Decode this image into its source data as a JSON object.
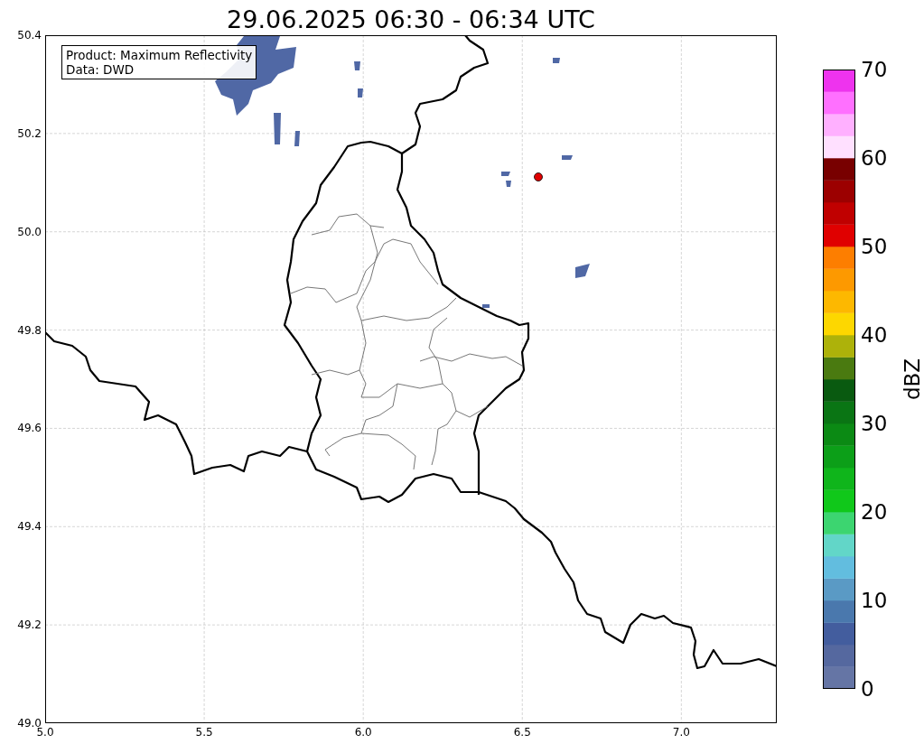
{
  "title": "29.06.2025 06:30 - 06:34 UTC",
  "info_box": {
    "lines": [
      "Product: Maximum Reflectivity",
      "Data: DWD"
    ]
  },
  "map": {
    "yticks": [
      "50.4",
      "50.2",
      "50.0",
      "49.8",
      "49.6",
      "49.4",
      "49.2",
      "49.0"
    ],
    "xticks": [
      "5.0",
      "5.5",
      "6.0",
      "6.5",
      "7.0"
    ]
  },
  "colorbar": {
    "label": "dBZ",
    "ticks": [
      "70",
      "60",
      "50",
      "40",
      "30",
      "20",
      "10",
      "0"
    ],
    "segments": [
      {
        "color": "#6575a5"
      },
      {
        "color": "#55689f"
      },
      {
        "color": "#435d9e"
      },
      {
        "color": "#4a78ad"
      },
      {
        "color": "#5a9ac5"
      },
      {
        "color": "#62bddf"
      },
      {
        "color": "#62d6c8"
      },
      {
        "color": "#3cd570"
      },
      {
        "color": "#10c81a"
      },
      {
        "color": "#0fb51b"
      },
      {
        "color": "#0c9f18"
      },
      {
        "color": "#0b8a14"
      },
      {
        "color": "#0a7514"
      },
      {
        "color": "#095a10"
      },
      {
        "color": "#4a7a10"
      },
      {
        "color": "#adb20a"
      },
      {
        "color": "#fdd700"
      },
      {
        "color": "#fdb800"
      },
      {
        "color": "#fd9900"
      },
      {
        "color": "#fd7e00"
      },
      {
        "color": "#e00000"
      },
      {
        "color": "#c00000"
      },
      {
        "color": "#9c0000"
      },
      {
        "color": "#780000"
      },
      {
        "color": "#ffe0ff"
      },
      {
        "color": "#ffb0ff"
      },
      {
        "color": "#ff70ff"
      },
      {
        "color": "#ee33ee"
      }
    ]
  }
}
